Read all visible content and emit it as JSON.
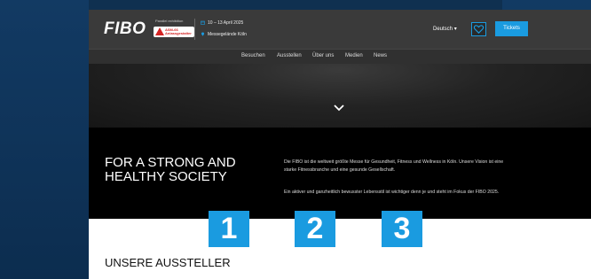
{
  "brand": {
    "logo": "FIBO",
    "partner_small": "Parallel exhibition",
    "partner_line1": "ASM-66",
    "partner_line2": "Anlassgestalter"
  },
  "event": {
    "date": "10 – 13 April 2025",
    "venue": "Messegelände Köln"
  },
  "header": {
    "language": "Deutsch",
    "tickets_label": "Tickets"
  },
  "nav": {
    "items": [
      "Besuchen",
      "Ausstellen",
      "Über uns",
      "Medien",
      "News"
    ]
  },
  "about": {
    "headline_line1": "FOR A STRONG AND",
    "headline_line2": "HEALTHY SOCIETY",
    "paragraph1": "Die FIBO ist die weltweit größte Messe für Gesundheit, Fitness und Wellness in Köln. Unsere Vision ist eine starke Fitnessbranche und eine gesunde Gesellschaft.",
    "paragraph2": "Ein aktiver und ganzheitlich bewusster Lebensstil ist wichtiger denn je und steht im Fokus der FIBO 2025."
  },
  "markers": [
    "1",
    "2",
    "3"
  ],
  "section_title": "UNSERE AUSSTELLER",
  "colors": {
    "accent": "#1a9be0",
    "header_bg": "#3a3a3a",
    "about_bg": "#000000"
  }
}
